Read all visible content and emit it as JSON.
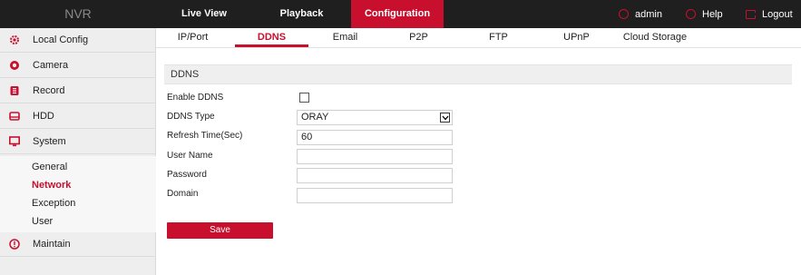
{
  "header": {
    "logo": "NVR",
    "tabs": [
      {
        "label": "Live View",
        "active": false
      },
      {
        "label": "Playback",
        "active": false
      },
      {
        "label": "Configuration",
        "active": true
      }
    ],
    "user": "admin",
    "help": "Help",
    "logout": "Logout",
    "accent_color": "#c8102e"
  },
  "sidebar": {
    "items": [
      {
        "label": "Local Config",
        "icon": "gear-icon"
      },
      {
        "label": "Camera",
        "icon": "camera-icon"
      },
      {
        "label": "Record",
        "icon": "record-icon"
      },
      {
        "label": "HDD",
        "icon": "hdd-icon"
      },
      {
        "label": "System",
        "icon": "monitor-icon"
      },
      {
        "label": "Maintain",
        "icon": "info-icon"
      }
    ],
    "subitems": [
      {
        "label": "General",
        "active": false
      },
      {
        "label": "Network",
        "active": true
      },
      {
        "label": "Exception",
        "active": false
      },
      {
        "label": "User",
        "active": false
      }
    ]
  },
  "subtabs": [
    {
      "label": "IP/Port",
      "active": false
    },
    {
      "label": "DDNS",
      "active": true
    },
    {
      "label": "Email",
      "active": false
    },
    {
      "label": "P2P",
      "active": false
    },
    {
      "label": "FTP",
      "active": false
    },
    {
      "label": "UPnP",
      "active": false
    },
    {
      "label": "Cloud Storage",
      "active": false
    }
  ],
  "section": {
    "title": "DDNS"
  },
  "form": {
    "enable_label": "Enable DDNS",
    "enable_checked": false,
    "type_label": "DDNS Type",
    "type_value": "ORAY",
    "refresh_label": "Refresh Time(Sec)",
    "refresh_value": "60",
    "username_label": "User Name",
    "username_value": "",
    "password_label": "Password",
    "password_value": "",
    "domain_label": "Domain",
    "domain_value": ""
  },
  "save_label": "Save"
}
